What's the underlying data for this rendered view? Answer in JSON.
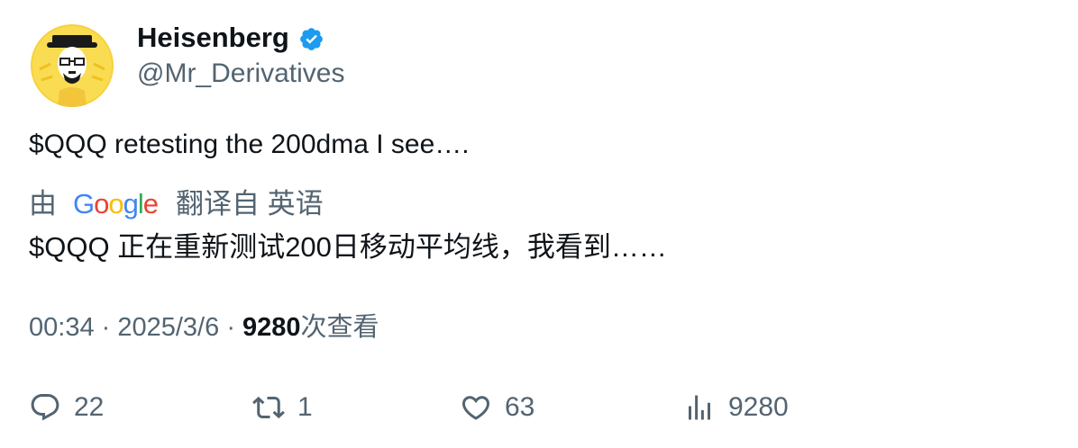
{
  "author": {
    "display_name": "Heisenberg",
    "handle": "@Mr_Derivatives",
    "avatar_icon": "heisenberg-avatar",
    "verified_color": "#1d9bf0"
  },
  "tweet": {
    "text": "$QQQ retesting the 200dma I see….",
    "translation_prefix": "由",
    "translation_provider": "Google",
    "translation_suffix": "翻译自 英语",
    "translated_text": "$QQQ 正在重新测试200日移动平均线，我看到……"
  },
  "meta": {
    "time": "00:34",
    "separator": "·",
    "date": "2025/3/6",
    "views_count": "9280",
    "views_label": "次查看"
  },
  "actions": {
    "reply_count": "22",
    "retweet_count": "1",
    "like_count": "63",
    "views_count": "9280"
  }
}
